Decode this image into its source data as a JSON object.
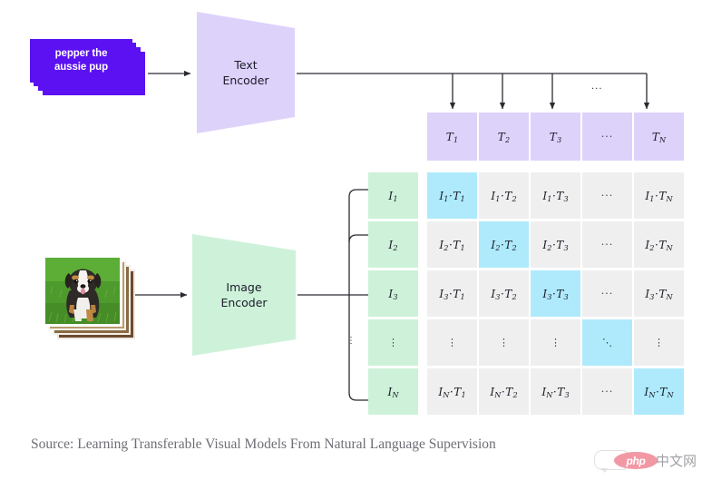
{
  "figure": {
    "title": "CLIP contrastive pre-training diagram",
    "caption": "Source: Learning Transferable Visual Models From Natural Language Supervision"
  },
  "text_input": {
    "label": "pepper the\naussie pup",
    "color": "#5b11f2",
    "stack_count": 4
  },
  "image_input": {
    "alt": "australian-shepherd-puppy-on-grass",
    "stack_count": 4
  },
  "encoders": [
    {
      "id": "text-encoder",
      "label": "Text\nEncoder",
      "color": "#ddd2fa"
    },
    {
      "id": "image-encoder",
      "label": "Image\nEncoder",
      "color": "#cdf2d9"
    }
  ],
  "text_embeddings": {
    "color": "#ddd2fa",
    "cells": [
      {
        "base": "T",
        "sub": "1",
        "ellipsis": false
      },
      {
        "base": "T",
        "sub": "2",
        "ellipsis": false
      },
      {
        "base": "T",
        "sub": "3",
        "ellipsis": false
      },
      {
        "base": "",
        "sub": "",
        "ellipsis": true,
        "glyph": "···"
      },
      {
        "base": "T",
        "sub": "N",
        "ellipsis": false
      }
    ]
  },
  "image_embeddings": {
    "color": "#cdf2d9",
    "cells": [
      {
        "base": "I",
        "sub": "1",
        "ellipsis": false
      },
      {
        "base": "I",
        "sub": "2",
        "ellipsis": false
      },
      {
        "base": "I",
        "sub": "3",
        "ellipsis": false
      },
      {
        "base": "",
        "sub": "",
        "ellipsis": true,
        "glyph": "⋮"
      },
      {
        "base": "I",
        "sub": "N",
        "ellipsis": false
      }
    ]
  },
  "similarity_matrix": {
    "cell_color": "#efefef",
    "diagonal_color": "#aeeafc",
    "col_labels": [
      "1",
      "2",
      "3",
      "···",
      "N"
    ],
    "row_labels": [
      "1",
      "2",
      "3",
      "⋮",
      "N"
    ],
    "rows": [
      [
        {
          "text": "I₁·T₁",
          "i": "1",
          "t": "1",
          "diag": true
        },
        {
          "text": "I₁·T₂",
          "i": "1",
          "t": "2",
          "diag": false
        },
        {
          "text": "I₁·T₃",
          "i": "1",
          "t": "3",
          "diag": false
        },
        {
          "text": "···",
          "ellipsis": true,
          "diag": false
        },
        {
          "text": "I₁·Tₙ",
          "i": "1",
          "t": "N",
          "diag": false
        }
      ],
      [
        {
          "text": "I₂·T₁",
          "i": "2",
          "t": "1",
          "diag": false
        },
        {
          "text": "I₂·T₂",
          "i": "2",
          "t": "2",
          "diag": true
        },
        {
          "text": "I₂·T₃",
          "i": "2",
          "t": "3",
          "diag": false
        },
        {
          "text": "···",
          "ellipsis": true,
          "diag": false
        },
        {
          "text": "I₂·Tₙ",
          "i": "2",
          "t": "N",
          "diag": false
        }
      ],
      [
        {
          "text": "I₃·T₁",
          "i": "3",
          "t": "1",
          "diag": false
        },
        {
          "text": "I₃·T₂",
          "i": "3",
          "t": "2",
          "diag": false
        },
        {
          "text": "I₃·T₃",
          "i": "3",
          "t": "3",
          "diag": true
        },
        {
          "text": "···",
          "ellipsis": true,
          "diag": false
        },
        {
          "text": "I₃·Tₙ",
          "i": "3",
          "t": "N",
          "diag": false
        }
      ],
      [
        {
          "text": "⋮",
          "ellipsis": true,
          "diag": false
        },
        {
          "text": "⋮",
          "ellipsis": true,
          "diag": false
        },
        {
          "text": "⋮",
          "ellipsis": true,
          "diag": false
        },
        {
          "text": "⋱",
          "ellipsis": true,
          "diag": true
        },
        {
          "text": "⋮",
          "ellipsis": true,
          "diag": false
        }
      ],
      [
        {
          "text": "Iₙ·T₁",
          "i": "N",
          "t": "1",
          "diag": false
        },
        {
          "text": "Iₙ·T₂",
          "i": "N",
          "t": "2",
          "diag": false
        },
        {
          "text": "Iₙ·T₃",
          "i": "N",
          "t": "3",
          "diag": false
        },
        {
          "text": "···",
          "ellipsis": true,
          "diag": false
        },
        {
          "text": "Iₙ·Tₙ",
          "i": "N",
          "t": "N",
          "diag": true
        }
      ]
    ]
  },
  "ellipses": {
    "top_row_dots": "···",
    "branch_dots": "⋮"
  },
  "watermark": {
    "logo_text": "php",
    "site_text": "中文网",
    "logo_color": "#e8455a"
  }
}
